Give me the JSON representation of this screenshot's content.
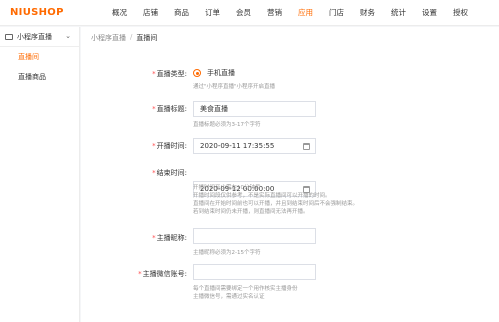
{
  "app": {
    "logo": "NIUSHOP"
  },
  "topnav": [
    "概况",
    "店铺",
    "商品",
    "订单",
    "会员",
    "营销",
    "应用",
    "门店",
    "财务",
    "统计",
    "设置",
    "授权"
  ],
  "topnav_active": "应用",
  "sidebar": {
    "header": "小程序直播",
    "items": [
      {
        "label": "直播间",
        "active": true
      },
      {
        "label": "直播商品",
        "active": false
      }
    ]
  },
  "breadcrumb": {
    "parent": "小程序直播",
    "separator": "/",
    "current": "直播间"
  },
  "form": {
    "live_type": {
      "label": "直播类型:",
      "option": "手机直播",
      "hint": "通过\"小程序直播\"小程序开启直播"
    },
    "title": {
      "label": "直播标题:",
      "value": "美食直播",
      "hint": "直播标题必须为3-17个字符"
    },
    "start_time": {
      "label": "开播时间:",
      "value": "2020-09-11 17:35:55"
    },
    "end_time": {
      "label": "结束时间:",
      "value": "2020-09-12 00:00:00",
      "hints": [
        "开播时间至少需在10分钟后",
        "开播时间段仅供参考，不是实际直播间可以开播的时间。",
        "直播间在开始时间前也可以开播，并且到结束时间后不会强制结束。",
        "若到结束时间仍未开播，则直播间无法再开播。"
      ]
    },
    "anchor_name": {
      "label": "主播昵称:",
      "value": "",
      "hint": "主播昵称必须为2-15个字符"
    },
    "anchor_wechat": {
      "label": "主播微信账号:",
      "value": "",
      "hints": [
        "每个直播间需要绑定一个用作核实主播身份",
        "主播微信号，需通过实名认证"
      ]
    }
  },
  "colors": {
    "accent": "#ff6a00",
    "required": "#ff4d4f"
  }
}
